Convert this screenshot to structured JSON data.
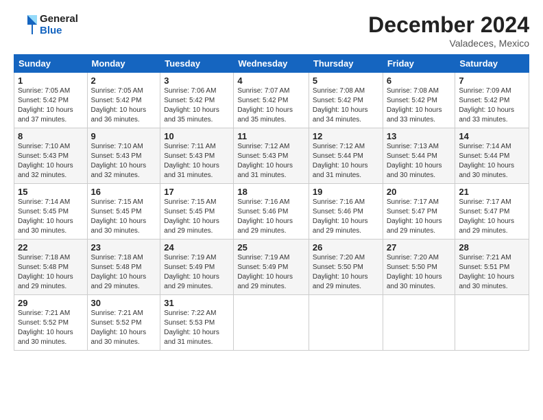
{
  "logo": {
    "line1": "General",
    "line2": "Blue"
  },
  "header": {
    "month": "December 2024",
    "location": "Valadeces, Mexico"
  },
  "weekdays": [
    "Sunday",
    "Monday",
    "Tuesday",
    "Wednesday",
    "Thursday",
    "Friday",
    "Saturday"
  ],
  "weeks": [
    [
      {
        "day": "1",
        "sunrise": "7:05 AM",
        "sunset": "5:42 PM",
        "daylight": "10 hours and 37 minutes."
      },
      {
        "day": "2",
        "sunrise": "7:05 AM",
        "sunset": "5:42 PM",
        "daylight": "10 hours and 36 minutes."
      },
      {
        "day": "3",
        "sunrise": "7:06 AM",
        "sunset": "5:42 PM",
        "daylight": "10 hours and 35 minutes."
      },
      {
        "day": "4",
        "sunrise": "7:07 AM",
        "sunset": "5:42 PM",
        "daylight": "10 hours and 35 minutes."
      },
      {
        "day": "5",
        "sunrise": "7:08 AM",
        "sunset": "5:42 PM",
        "daylight": "10 hours and 34 minutes."
      },
      {
        "day": "6",
        "sunrise": "7:08 AM",
        "sunset": "5:42 PM",
        "daylight": "10 hours and 33 minutes."
      },
      {
        "day": "7",
        "sunrise": "7:09 AM",
        "sunset": "5:42 PM",
        "daylight": "10 hours and 33 minutes."
      }
    ],
    [
      {
        "day": "8",
        "sunrise": "7:10 AM",
        "sunset": "5:43 PM",
        "daylight": "10 hours and 32 minutes."
      },
      {
        "day": "9",
        "sunrise": "7:10 AM",
        "sunset": "5:43 PM",
        "daylight": "10 hours and 32 minutes."
      },
      {
        "day": "10",
        "sunrise": "7:11 AM",
        "sunset": "5:43 PM",
        "daylight": "10 hours and 31 minutes."
      },
      {
        "day": "11",
        "sunrise": "7:12 AM",
        "sunset": "5:43 PM",
        "daylight": "10 hours and 31 minutes."
      },
      {
        "day": "12",
        "sunrise": "7:12 AM",
        "sunset": "5:44 PM",
        "daylight": "10 hours and 31 minutes."
      },
      {
        "day": "13",
        "sunrise": "7:13 AM",
        "sunset": "5:44 PM",
        "daylight": "10 hours and 30 minutes."
      },
      {
        "day": "14",
        "sunrise": "7:14 AM",
        "sunset": "5:44 PM",
        "daylight": "10 hours and 30 minutes."
      }
    ],
    [
      {
        "day": "15",
        "sunrise": "7:14 AM",
        "sunset": "5:45 PM",
        "daylight": "10 hours and 30 minutes."
      },
      {
        "day": "16",
        "sunrise": "7:15 AM",
        "sunset": "5:45 PM",
        "daylight": "10 hours and 30 minutes."
      },
      {
        "day": "17",
        "sunrise": "7:15 AM",
        "sunset": "5:45 PM",
        "daylight": "10 hours and 29 minutes."
      },
      {
        "day": "18",
        "sunrise": "7:16 AM",
        "sunset": "5:46 PM",
        "daylight": "10 hours and 29 minutes."
      },
      {
        "day": "19",
        "sunrise": "7:16 AM",
        "sunset": "5:46 PM",
        "daylight": "10 hours and 29 minutes."
      },
      {
        "day": "20",
        "sunrise": "7:17 AM",
        "sunset": "5:47 PM",
        "daylight": "10 hours and 29 minutes."
      },
      {
        "day": "21",
        "sunrise": "7:17 AM",
        "sunset": "5:47 PM",
        "daylight": "10 hours and 29 minutes."
      }
    ],
    [
      {
        "day": "22",
        "sunrise": "7:18 AM",
        "sunset": "5:48 PM",
        "daylight": "10 hours and 29 minutes."
      },
      {
        "day": "23",
        "sunrise": "7:18 AM",
        "sunset": "5:48 PM",
        "daylight": "10 hours and 29 minutes."
      },
      {
        "day": "24",
        "sunrise": "7:19 AM",
        "sunset": "5:49 PM",
        "daylight": "10 hours and 29 minutes."
      },
      {
        "day": "25",
        "sunrise": "7:19 AM",
        "sunset": "5:49 PM",
        "daylight": "10 hours and 29 minutes."
      },
      {
        "day": "26",
        "sunrise": "7:20 AM",
        "sunset": "5:50 PM",
        "daylight": "10 hours and 29 minutes."
      },
      {
        "day": "27",
        "sunrise": "7:20 AM",
        "sunset": "5:50 PM",
        "daylight": "10 hours and 30 minutes."
      },
      {
        "day": "28",
        "sunrise": "7:21 AM",
        "sunset": "5:51 PM",
        "daylight": "10 hours and 30 minutes."
      }
    ],
    [
      {
        "day": "29",
        "sunrise": "7:21 AM",
        "sunset": "5:52 PM",
        "daylight": "10 hours and 30 minutes."
      },
      {
        "day": "30",
        "sunrise": "7:21 AM",
        "sunset": "5:52 PM",
        "daylight": "10 hours and 30 minutes."
      },
      {
        "day": "31",
        "sunrise": "7:22 AM",
        "sunset": "5:53 PM",
        "daylight": "10 hours and 31 minutes."
      },
      null,
      null,
      null,
      null
    ]
  ]
}
